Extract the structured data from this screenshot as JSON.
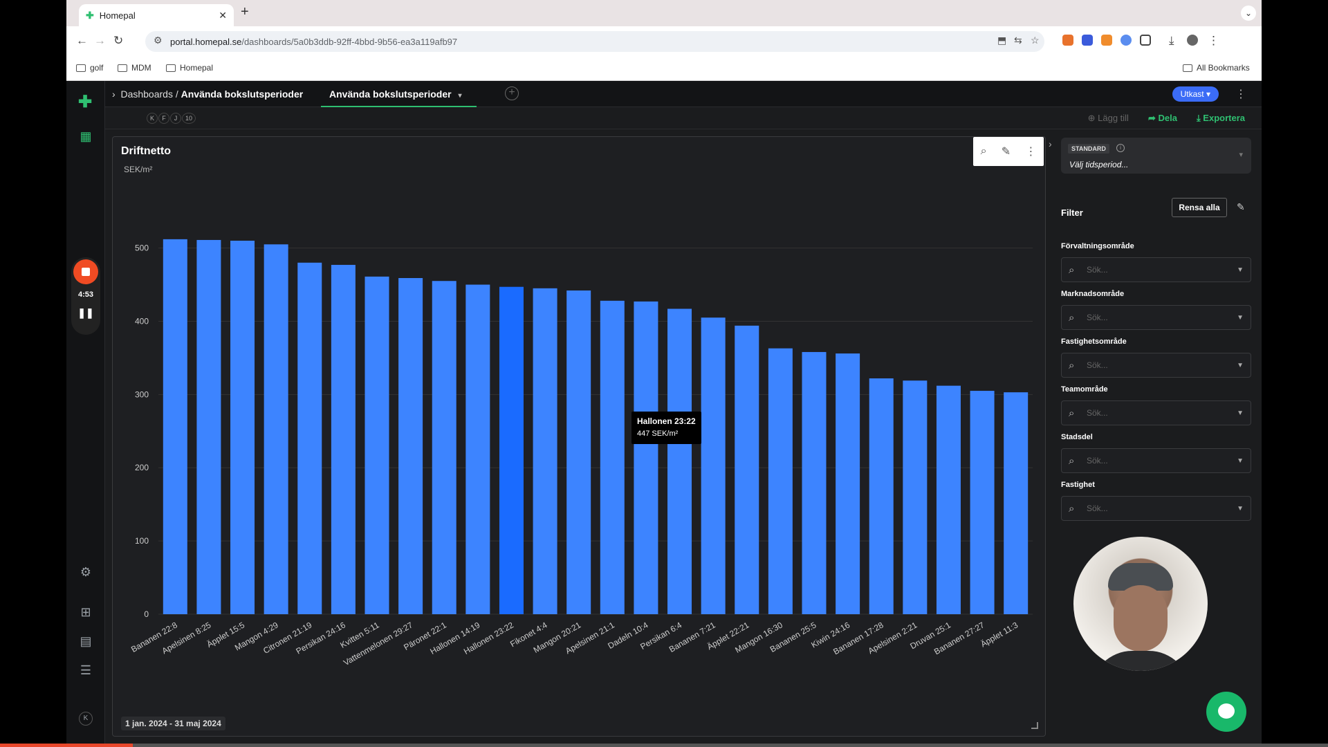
{
  "browser": {
    "tab_title": "Homepal",
    "url_host": "portal.homepal.se",
    "url_path": "/dashboards/5a0b3ddb-92ff-4bbd-9b56-ea3a119afb97",
    "bookmarks": [
      "golf",
      "MDM",
      "Homepal"
    ],
    "all_bookmarks": "All Bookmarks"
  },
  "app": {
    "breadcrumb_root": "Dashboards /",
    "breadcrumb_current": "Använda bokslutsperioder",
    "dashboard_tab": "Använda bokslutsperioder",
    "status": "Utkast",
    "chips": [
      "K",
      "F",
      "J",
      "10"
    ],
    "actions": {
      "add": "Lägg till",
      "share": "Dela",
      "export": "Exportera"
    },
    "recorder_time": "4:53",
    "rail_bottom_chip": "K"
  },
  "chart_card": {
    "title": "Driftnetto",
    "unit": "SEK/m²",
    "date_range": "1 jan. 2024 - 31 maj 2024",
    "tooltip": {
      "category": "Hallonen 23:22",
      "value_label": "447 SEK/m²"
    }
  },
  "chart_data": {
    "type": "bar",
    "title": "Driftnetto",
    "ylabel": "SEK/m²",
    "ylim": [
      0,
      500
    ],
    "yticks": [
      0,
      100,
      200,
      300,
      400,
      500
    ],
    "grid": true,
    "highlight_index": 10,
    "colors": {
      "bar": "#3d84ff",
      "highlight": "#1a6bff"
    },
    "categories": [
      "Bananen 22:8",
      "Apelsinen 8:25",
      "Äpplet 15:5",
      "Mangon 4:29",
      "Citronen 21:19",
      "Persikan 24:16",
      "Kvitten 5:11",
      "Vattenmelonen 29:27",
      "Päronet 22:1",
      "Hallonen 14:19",
      "Hallonen 23:22",
      "Fikonet 4:4",
      "Mangon 20:21",
      "Apelsinen 21:1",
      "Dadeln 10:4",
      "Persikan 6:4",
      "Bananen 7:21",
      "Äpplet 22:21",
      "Mangon 16:30",
      "Bananen 25:5",
      "Kiwin 24:16",
      "Bananen 17:28",
      "Apelsinen 2:21",
      "Druvan 25:1",
      "Bananen 27:27",
      "Äpplet 11:3"
    ],
    "values": [
      512,
      511,
      510,
      505,
      480,
      477,
      461,
      459,
      455,
      450,
      447,
      445,
      442,
      428,
      427,
      417,
      405,
      394,
      363,
      358,
      356,
      322,
      319,
      312,
      305,
      303
    ]
  },
  "filters": {
    "period_badge": "STANDARD",
    "period_placeholder": "Välj tidsperiod...",
    "label": "Filter",
    "clear": "Rensa alla",
    "placeholder": "Sök...",
    "items": [
      "Förvaltningsområde",
      "Marknadsområde",
      "Fastighetsområde",
      "Teamområde",
      "Stadsdel",
      "Fastighet"
    ]
  },
  "video": {
    "progress": 0.1
  }
}
